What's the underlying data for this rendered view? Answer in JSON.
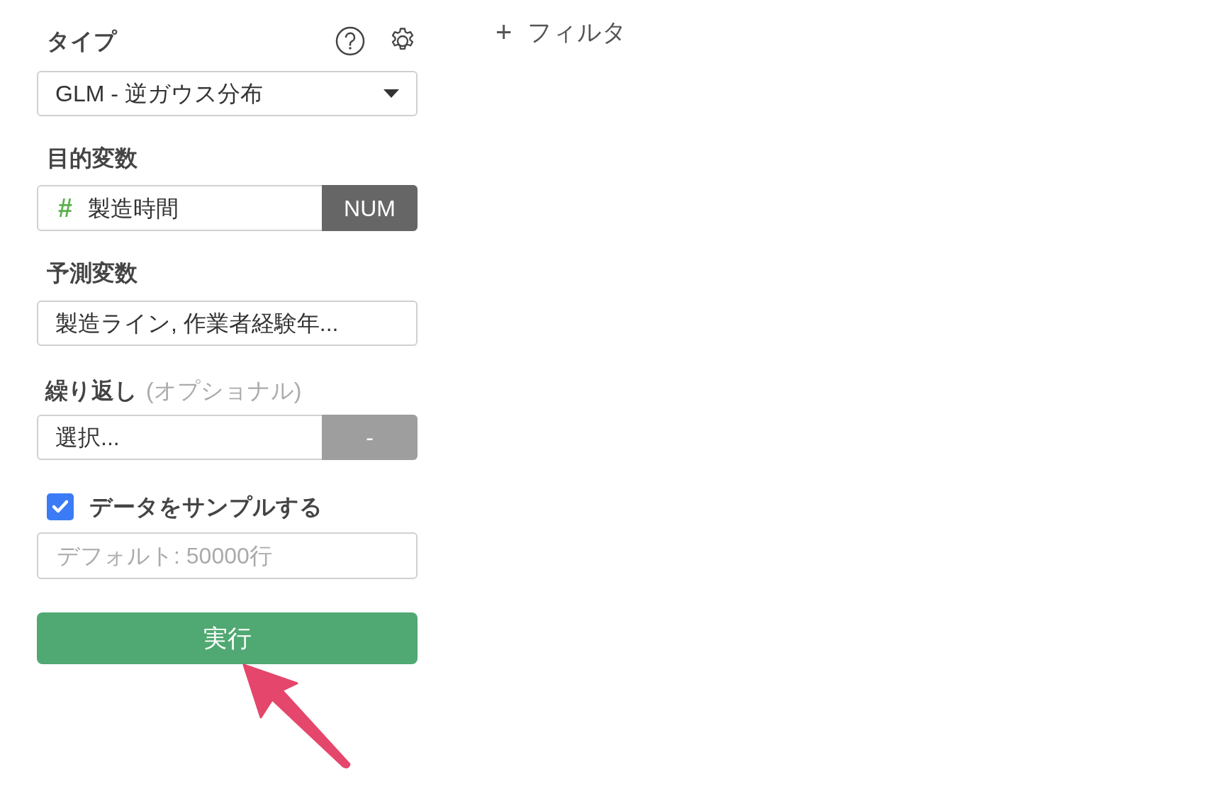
{
  "type_section": {
    "label": "タイプ",
    "select": {
      "value": "GLM - 逆ガウス分布"
    }
  },
  "target": {
    "label": "目的変数",
    "icon": "#",
    "value": "製造時間",
    "badge": "NUM"
  },
  "predictors": {
    "label": "予測変数",
    "value": "製造ライン, 作業者経験年..."
  },
  "repeat": {
    "label": "繰り返し",
    "hint": "(オプショナル)",
    "value": "選択...",
    "badge": "-"
  },
  "sample": {
    "label": "データをサンプルする",
    "checked": true,
    "placeholder": "デフォルト: 50000行"
  },
  "run_button": "実行",
  "filter": {
    "icon": "+",
    "label": "フィルタ"
  }
}
